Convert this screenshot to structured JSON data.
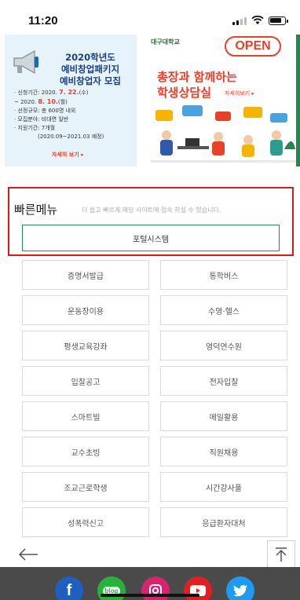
{
  "status_bar": {
    "time": "11:20"
  },
  "banner_left": {
    "title_line1": "2020학년도",
    "title_line2": "예비창업패키지",
    "title_line3": "예비창업자 모집",
    "info_label1": "· 신청기간: 2020. ",
    "info_date1": "7. 22.",
    "info_day1": "(수)",
    "info_label2": "  ~ 2020. ",
    "info_date2": "8. 10.",
    "info_day2": "(월)",
    "info_line3": "· 선정규모: 총 600명 내외",
    "info_line4": "· 모집분야: 비대면 일반",
    "info_line5": "· 지원기간: 7개월",
    "info_line6": "(2020.09~2021.03 예정)",
    "more": "자세히 보기 ▸"
  },
  "banner_right": {
    "logo_text": "대구대학교",
    "open_badge": "OPEN",
    "title_line1": "총장과 함께하는",
    "title_line2": "학생상담실",
    "more": "자세히보기 ▸"
  },
  "quick_menu": {
    "title": "빠른메뉴",
    "description": "더 쉽고 빠르게 해당 사이트에 접속 하실 수 있습니다.",
    "portal": "포털시스템",
    "items": [
      "증명서발급",
      "통학버스",
      "운동장이용",
      "수영·헬스",
      "평생교육강좌",
      "영덕연수원",
      "입찰공고",
      "전자입찰",
      "스마트빌",
      "메일활용",
      "교수초빙",
      "직원채용",
      "조교근로학생",
      "시간강사풀",
      "성폭력신고",
      "응급환자대처"
    ]
  },
  "nav": {
    "back_icon": "arrow-left-icon",
    "top_icon": "arrow-up-icon"
  },
  "social": [
    {
      "name": "facebook-icon",
      "glyph": "f",
      "color": "#1f5fbf"
    },
    {
      "name": "blog-icon",
      "glyph": "blog",
      "color": "#25b43b"
    },
    {
      "name": "instagram-icon",
      "glyph": "◎",
      "color": "#d6246e"
    },
    {
      "name": "youtube-icon",
      "glyph": "▶",
      "color": "#e02020"
    },
    {
      "name": "twitter-icon",
      "glyph": "🐦",
      "color": "#1d9bf0"
    }
  ],
  "colors": {
    "highlight_border": "#d81920",
    "portal_border": "#2e8b57",
    "footer": "#4a4a4a"
  }
}
